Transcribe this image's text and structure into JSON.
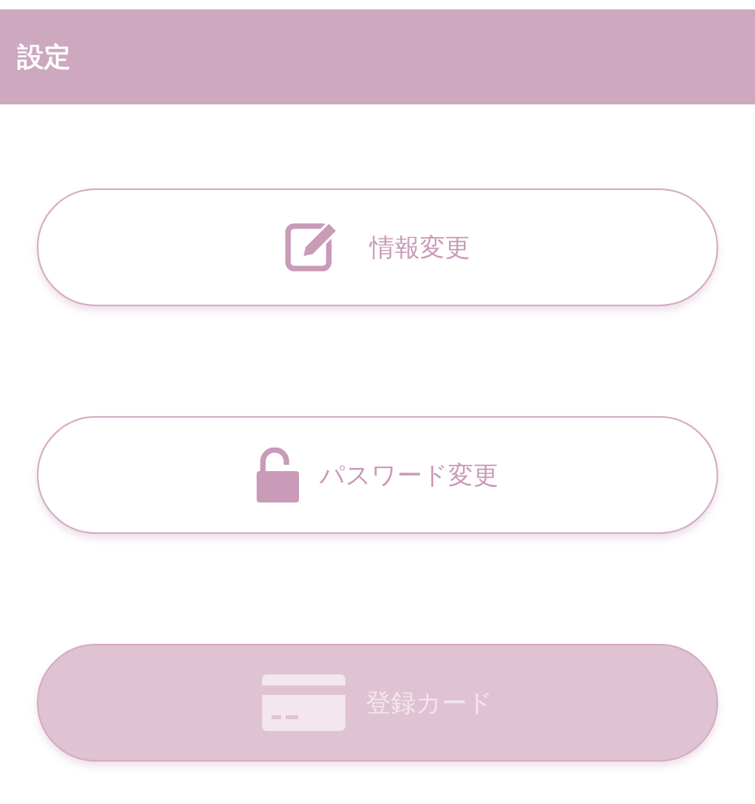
{
  "header": {
    "title": "設定"
  },
  "buttons": [
    {
      "kind": "edit",
      "label": "情報変更",
      "disabled": false
    },
    {
      "kind": "unlock",
      "label": "パスワード変更",
      "disabled": false
    },
    {
      "kind": "card",
      "label": "登録カード",
      "disabled": true
    }
  ]
}
